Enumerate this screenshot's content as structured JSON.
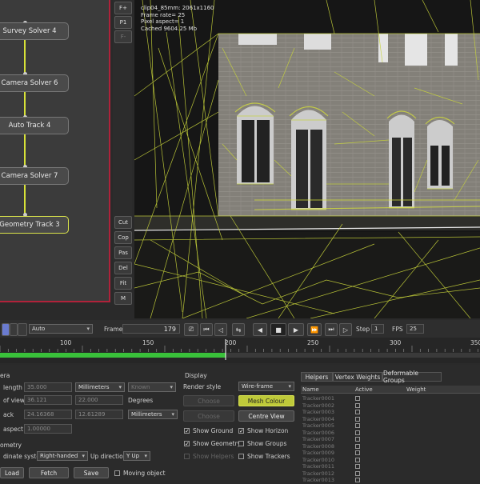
{
  "graph": {
    "nodes": [
      "Survey Solver 4",
      "Camera Solver 6",
      "Auto Track 4",
      "Camera Solver 7",
      "Geometry Track 3"
    ]
  },
  "side_buttons": {
    "top": [
      "F+",
      "P1",
      "F-"
    ],
    "bottom": [
      "Cut",
      "Cop",
      "Pas",
      "Del",
      "Fit",
      "M"
    ]
  },
  "hud": {
    "line1": "clip04_85mm: 2061x1160",
    "line2": "Frame rate= 25",
    "line3": "Pixel aspect= 1",
    "line4": "Cached 9604.25 Mb"
  },
  "playback": {
    "mode": "Auto",
    "frame_label": "Frame",
    "frame_value": "179",
    "step_label": "Step",
    "step_value": "1",
    "fps_label": "FPS",
    "fps_value": "25"
  },
  "timeline": {
    "ticks": [
      "100",
      "150",
      "200",
      "250",
      "300",
      "350"
    ],
    "progress_fraction": 0.47
  },
  "camera": {
    "header": "era",
    "length_label": "length",
    "length_value": "35.000",
    "length_unit": "Millimeters",
    "length_extra": "Known",
    "fov_label": "of view",
    "fov_value1": "36.121",
    "fov_value2": "22.000",
    "fov_unit": "Degrees",
    "back_label": "ack",
    "back_value1": "24.16368",
    "back_value2": "12.61289",
    "back_unit": "Millimeters",
    "aspect_label": "aspect",
    "aspect_value": "1.00000"
  },
  "geometry": {
    "header": "ometry",
    "coord_label": "dinate system",
    "coord_value": "Right-handed",
    "updir_label": "Up direction",
    "updir_value": "Y Up",
    "load_label": "Load",
    "fetch_label": "Fetch",
    "save_label": "Save",
    "moving_label": "Moving object"
  },
  "display": {
    "header": "Display",
    "render_label": "Render style",
    "render_value": "Wire-frame",
    "choose_label": "Choose",
    "mesh_colour_label": "Mesh Colour",
    "choose2_label": "Choose",
    "centre_view_label": "Centre View",
    "show_ground": "Show Ground",
    "show_horizon": "Show Horizon",
    "show_geometry": "Show Geometry",
    "show_groups": "Show Groups",
    "show_helpers": "Show Helpers",
    "show_trackers": "Show Trackers"
  },
  "helpers": {
    "tabs": [
      "Helpers",
      "Vertex Weights",
      "Deformable Groups"
    ],
    "columns": [
      "Name",
      "Active",
      "Weight"
    ],
    "rows": [
      "Tracker0001",
      "Tracker0002",
      "Tracker0003",
      "Tracker0004",
      "Tracker0005",
      "Tracker0006",
      "Tracker0007",
      "Tracker0008",
      "Tracker0009",
      "Tracker0010",
      "Tracker0011",
      "Tracker0012",
      "Tracker0013"
    ]
  },
  "colors": {
    "accent": "#d7e238",
    "graph_border": "#b0223a",
    "mesh": "#c8d43a"
  }
}
